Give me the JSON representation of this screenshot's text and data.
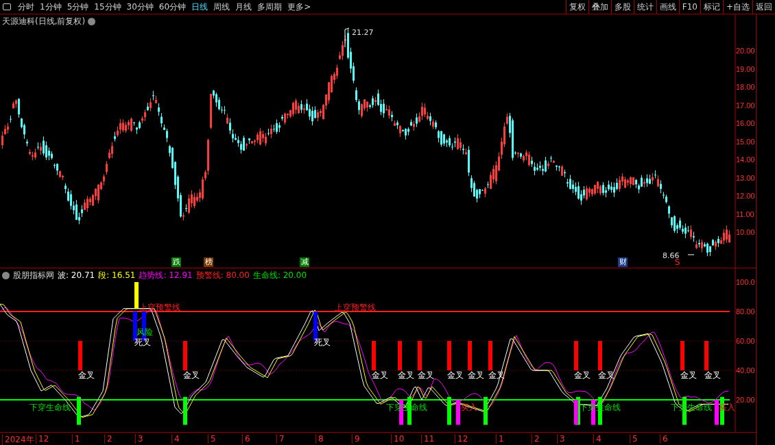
{
  "toolbar": {
    "periods": [
      {
        "label": "分时",
        "selected": false
      },
      {
        "label": "1分钟",
        "selected": false
      },
      {
        "label": "5分钟",
        "selected": false
      },
      {
        "label": "15分钟",
        "selected": false
      },
      {
        "label": "30分钟",
        "selected": false
      },
      {
        "label": "60分钟",
        "selected": false
      },
      {
        "label": "日线",
        "selected": true
      },
      {
        "label": "周线",
        "selected": false
      },
      {
        "label": "月线",
        "selected": false
      },
      {
        "label": "多周期",
        "selected": false
      },
      {
        "label": "更多>",
        "selected": false
      }
    ],
    "buttons": [
      "复权",
      "叠加",
      "多股",
      "统计",
      "画线",
      "F10",
      "标记",
      "+自选",
      "返回"
    ]
  },
  "price_chart": {
    "title": "天源迪科(日线,前复权)",
    "high_label": "21.27",
    "low_label": "8.66",
    "axis": [
      "20.00",
      "19.00",
      "18.00",
      "17.00",
      "16.00",
      "15.00",
      "14.00",
      "13.00",
      "12.00",
      "11.00",
      "10.00"
    ],
    "markers": [
      {
        "kind": "tag",
        "label": "跌",
        "color": "#007a00"
      },
      {
        "kind": "tag",
        "label": "榜",
        "color": "#7a3a00"
      },
      {
        "kind": "tag",
        "label": "减",
        "color": "#007a00"
      },
      {
        "kind": "tag",
        "label": "财",
        "color": "#1c3c8c"
      },
      {
        "kind": "text",
        "label": "S",
        "color": "#ff2020"
      }
    ]
  },
  "indicator": {
    "name": "股朋指标网",
    "values": [
      {
        "label": "波: 20.71",
        "color": "#ffffff"
      },
      {
        "label": "段: 16.51",
        "color": "#ffff00"
      },
      {
        "label": "趋势线: 12.91",
        "color": "#ff00ff"
      },
      {
        "label": "预警线: 80.00",
        "color": "#ff2020"
      },
      {
        "label": "生命线: 20.00",
        "color": "#00e000"
      }
    ],
    "axis": [
      "100.0",
      "80.00",
      "60.00",
      "40.00",
      "20.00"
    ],
    "signals": [
      {
        "label": "金叉"
      },
      {
        "label": "金叉"
      },
      {
        "label": "金叉"
      },
      {
        "label": "金叉"
      },
      {
        "label": "金叉"
      },
      {
        "label": "金叉"
      },
      {
        "label": "金叉"
      },
      {
        "label": "金叉"
      },
      {
        "label": "金叉"
      },
      {
        "label": "金叉"
      },
      {
        "label": "金叉"
      },
      {
        "label": "金叉"
      }
    ],
    "annotations": [
      {
        "kind": "warn",
        "label": "上穿预警线"
      },
      {
        "kind": "warn",
        "label": "上穿预警线"
      },
      {
        "kind": "risk",
        "label": "风险"
      },
      {
        "kind": "death",
        "label": "死叉"
      },
      {
        "kind": "death",
        "label": "死叉"
      },
      {
        "kind": "life",
        "label": "下穿生命线"
      },
      {
        "kind": "life",
        "label": "下穿生命线"
      },
      {
        "kind": "buy",
        "label": "买入"
      },
      {
        "kind": "life",
        "label": "下穿生命线"
      },
      {
        "kind": "life",
        "label": "下穿生命线"
      },
      {
        "kind": "buy",
        "label": "买入"
      }
    ]
  },
  "time_axis": [
    "2024年",
    "12",
    "1",
    "2",
    "3",
    "4",
    "5",
    "6",
    "7",
    "8",
    "9",
    "10",
    "11",
    "12",
    "1",
    "2",
    "3",
    "4",
    "5",
    "6"
  ]
}
